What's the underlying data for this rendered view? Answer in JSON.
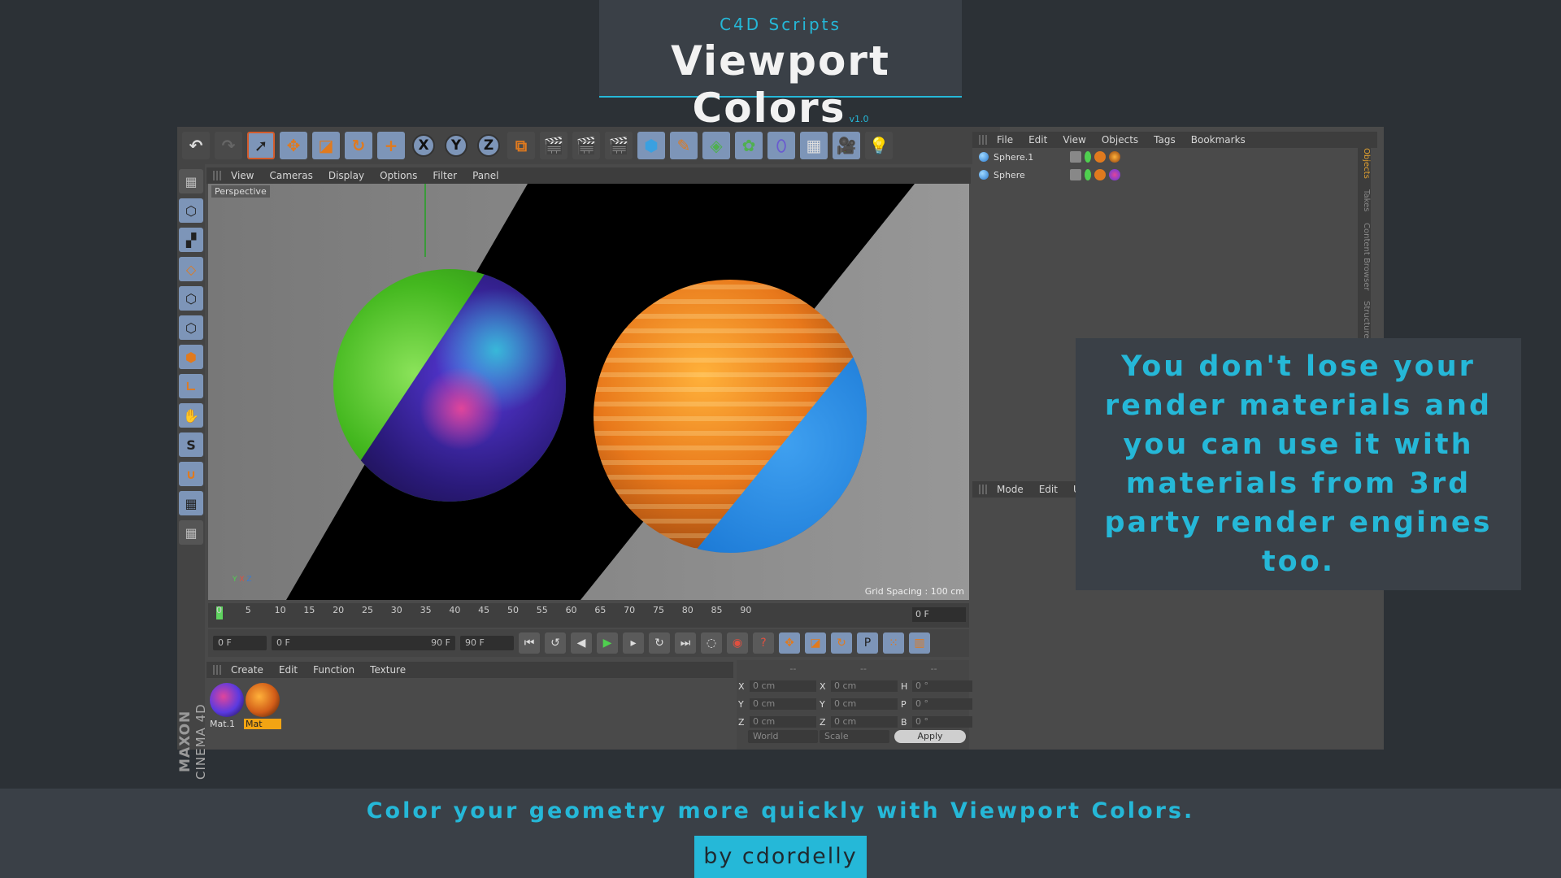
{
  "title": {
    "subtitle": "C4D Scripts",
    "main": "Viewport Colors",
    "version": "v1.0"
  },
  "c4d": {
    "toolbar_icons": [
      "undo-icon",
      "redo-icon",
      "select-icon",
      "move-icon",
      "scale-icon",
      "rotate-icon",
      "add-icon",
      "x-axis",
      "y-axis",
      "z-axis",
      "coord-system-icon",
      "render-view-icon",
      "render-icon",
      "render-settings-icon",
      "cube-icon",
      "pen-icon",
      "subdivision-icon",
      "cloner-icon",
      "deformer-icon",
      "floor-icon",
      "camera-icon",
      "light-icon"
    ],
    "axis_labels": [
      "X",
      "Y",
      "Z"
    ],
    "viewport_menu": [
      "View",
      "Cameras",
      "Display",
      "Options",
      "Filter",
      "Panel"
    ],
    "viewport_label": "Perspective",
    "grid_spacing": "Grid Spacing : 100 cm",
    "timeline_ticks": [
      "0",
      "5",
      "10",
      "15",
      "20",
      "25",
      "30",
      "35",
      "40",
      "45",
      "50",
      "55",
      "60",
      "65",
      "70",
      "75",
      "80",
      "85",
      "90"
    ],
    "timeline_end": "0 F",
    "transport_fields": {
      "current": "0 F",
      "range_start": "0 F",
      "range_end": "90 F",
      "max": "90 F"
    },
    "material_menu": [
      "Create",
      "Edit",
      "Function",
      "Texture"
    ],
    "materials": [
      {
        "name": "Mat.1"
      },
      {
        "name": "Mat"
      }
    ],
    "coords": {
      "headers": [
        "--",
        "--",
        "--"
      ],
      "rows": [
        {
          "a": "X",
          "av": "0 cm",
          "b": "X",
          "bv": "0 cm",
          "c": "H",
          "cv": "0 °"
        },
        {
          "a": "Y",
          "av": "0 cm",
          "b": "Y",
          "bv": "0 cm",
          "c": "P",
          "cv": "0 °"
        },
        {
          "a": "Z",
          "av": "0 cm",
          "b": "Z",
          "bv": "0 cm",
          "c": "B",
          "cv": "0 °"
        }
      ],
      "world": "World",
      "scale": "Scale",
      "apply": "Apply"
    },
    "object_menu": [
      "File",
      "Edit",
      "View",
      "Objects",
      "Tags",
      "Bookmarks"
    ],
    "objects": [
      {
        "name": "Sphere.1"
      },
      {
        "name": "Sphere"
      }
    ],
    "side_tabs": [
      "Objects",
      "Takes",
      "Content Browser",
      "Structure"
    ],
    "attr_menu": [
      "Mode",
      "Edit",
      "U"
    ],
    "brand": "MAXON",
    "brand_product": "CINEMA 4D"
  },
  "info": "You don't lose your render materials and you can use it with materials from 3rd party render engines too.",
  "footer": {
    "tagline": "Color your geometry more quickly with Viewport Colors.",
    "by": "by cdordelly"
  },
  "colors": {
    "accent": "#25b8d8",
    "background": "#2c3136",
    "card": "#3a4047"
  }
}
